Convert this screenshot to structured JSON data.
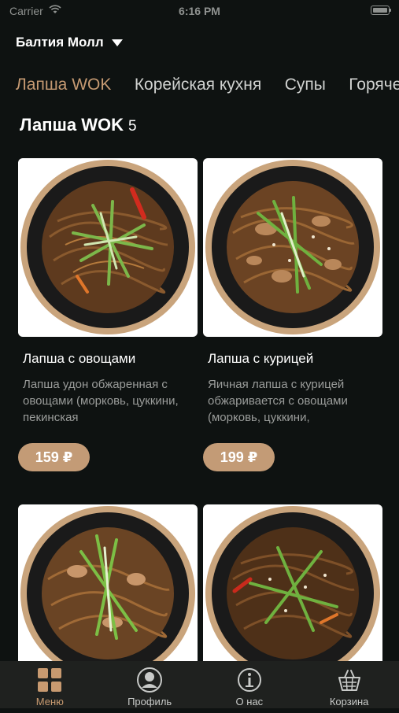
{
  "status_bar": {
    "carrier": "Carrier",
    "time": "6:16 PM"
  },
  "location": {
    "name": "Балтия Молл"
  },
  "tabs": [
    {
      "label": "Лапша WOK",
      "active": true
    },
    {
      "label": "Корейская кухня",
      "active": false
    },
    {
      "label": "Супы",
      "active": false
    },
    {
      "label": "Горячее",
      "active": false
    }
  ],
  "section": {
    "title": "Лапша WOK",
    "count": "5"
  },
  "products": [
    {
      "title": "Лапша с овощами",
      "description": "Лапша удон обжаренная с овощами (морковь, цуккини, пекинская",
      "price": "159 ₽"
    },
    {
      "title": "Лапша с курицей",
      "description": "Яичная лапша с курицей обжаривается с овощами (морковь, цуккини,",
      "price": "199 ₽"
    },
    {
      "title": "",
      "description": "",
      "price": ""
    },
    {
      "title": "",
      "description": "",
      "price": ""
    }
  ],
  "bottom_nav": [
    {
      "label": "Меню",
      "icon": "menu-grid-icon",
      "active": true
    },
    {
      "label": "Профиль",
      "icon": "profile-icon",
      "active": false
    },
    {
      "label": "О нас",
      "icon": "info-icon",
      "active": false
    },
    {
      "label": "Корзина",
      "icon": "basket-icon",
      "active": false
    }
  ],
  "colors": {
    "background": "#0e1211",
    "accent": "#c69a72",
    "price_badge": "#c39b76",
    "nav_bg": "#1f211f"
  }
}
